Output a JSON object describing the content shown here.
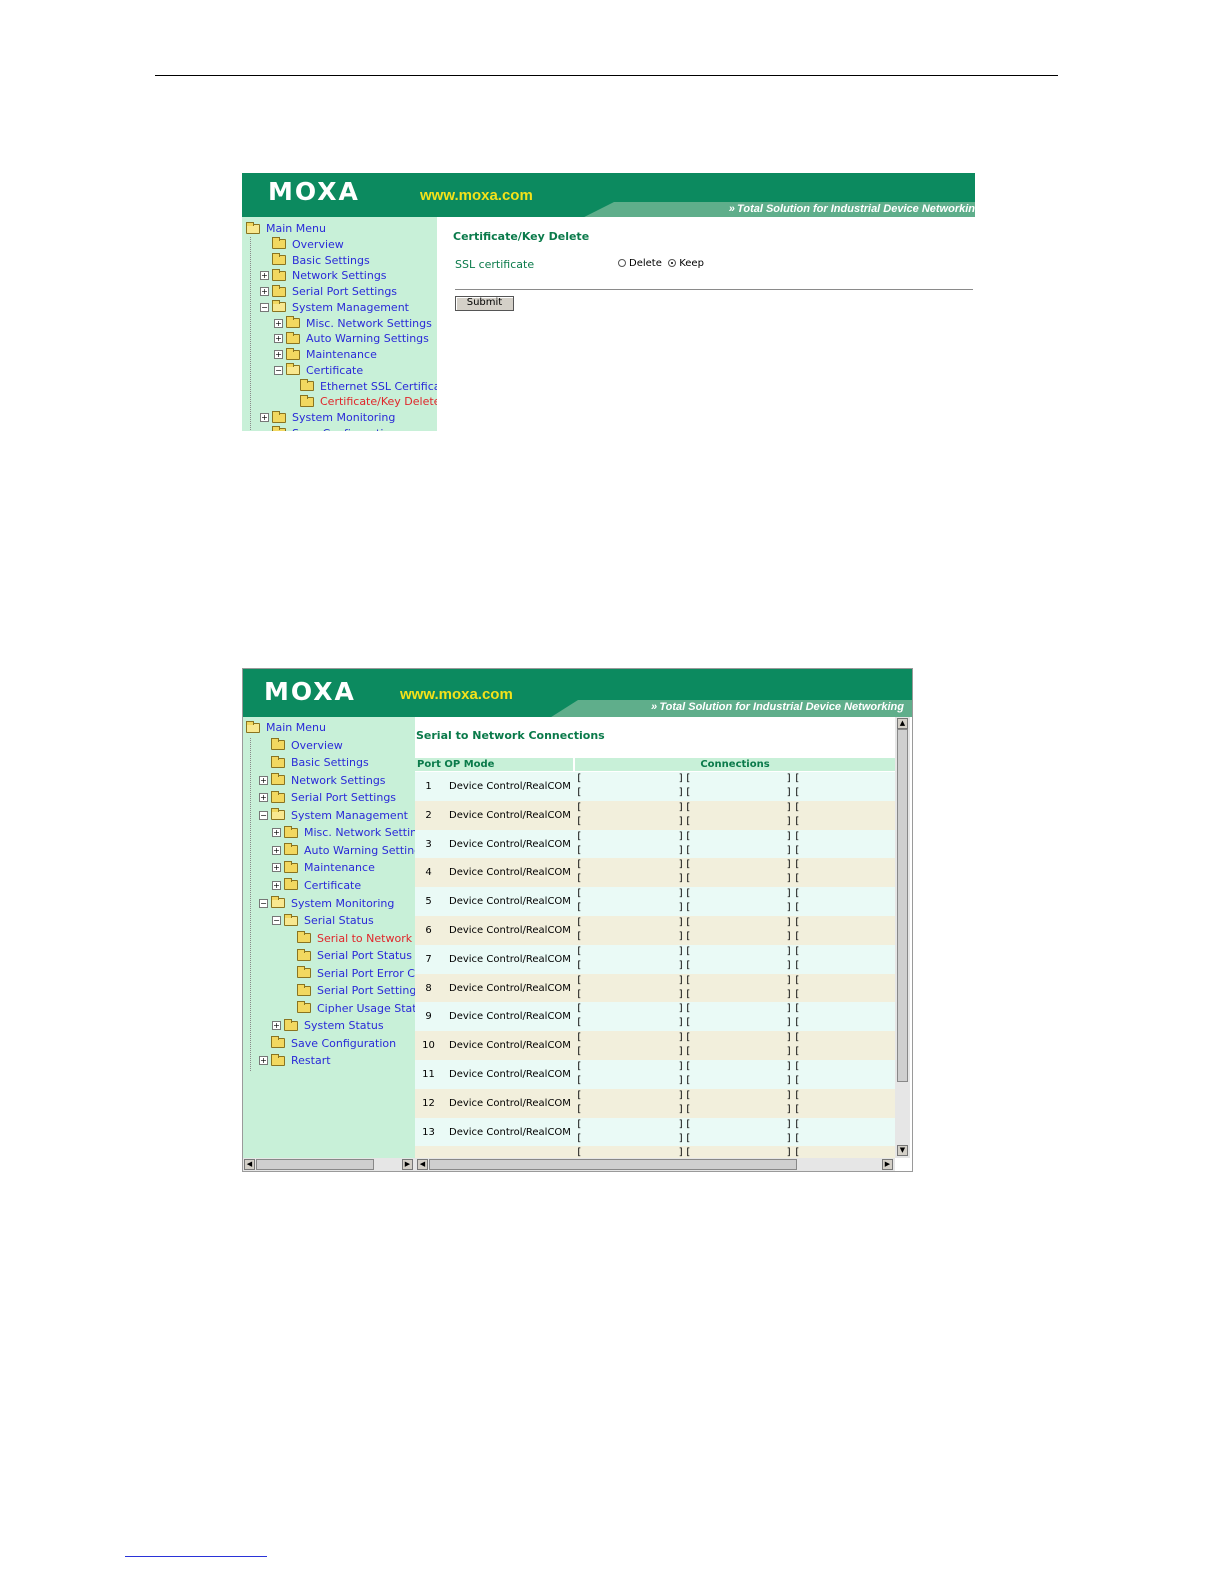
{
  "brand": {
    "logo": "MOXA",
    "url": "www.moxa.com",
    "tagline": "Total Solution for Industrial Device Networking"
  },
  "shot1": {
    "tagline": "Total Solution for Industrial Device Networkin",
    "menu": [
      {
        "label": "Main Menu",
        "level": 0,
        "expander": "",
        "open": true
      },
      {
        "label": "Overview",
        "level": 1,
        "expander": ""
      },
      {
        "label": "Basic Settings",
        "level": 1,
        "expander": ""
      },
      {
        "label": "Network Settings",
        "level": 1,
        "expander": "+"
      },
      {
        "label": "Serial Port Settings",
        "level": 1,
        "expander": "+"
      },
      {
        "label": "System Management",
        "level": 1,
        "expander": "-",
        "open": true
      },
      {
        "label": "Misc. Network Settings",
        "level": 2,
        "expander": "+"
      },
      {
        "label": "Auto Warning Settings",
        "level": 2,
        "expander": "+"
      },
      {
        "label": "Maintenance",
        "level": 2,
        "expander": "+"
      },
      {
        "label": "Certificate",
        "level": 2,
        "expander": "-",
        "open": true
      },
      {
        "label": "Ethernet SSL Certifica",
        "level": 3,
        "expander": ""
      },
      {
        "label": "Certificate/Key Delete",
        "level": 3,
        "expander": "",
        "active": true
      },
      {
        "label": "System Monitoring",
        "level": 1,
        "expander": "+"
      },
      {
        "label": "Save Configuration",
        "level": 1,
        "expander": ""
      }
    ],
    "title": "Certificate/Key Delete",
    "field_label": "SSL certificate",
    "options": [
      "Delete",
      "Keep"
    ],
    "selected": "Keep",
    "submit": "Submit"
  },
  "shot2": {
    "menu": [
      {
        "label": "Main Menu",
        "level": 0,
        "expander": "",
        "open": true
      },
      {
        "label": "Overview",
        "level": 1,
        "expander": ""
      },
      {
        "label": "Basic Settings",
        "level": 1,
        "expander": ""
      },
      {
        "label": "Network Settings",
        "level": 1,
        "expander": "+"
      },
      {
        "label": "Serial Port Settings",
        "level": 1,
        "expander": "+"
      },
      {
        "label": "System Management",
        "level": 1,
        "expander": "-",
        "open": true
      },
      {
        "label": "Misc. Network Settings",
        "level": 2,
        "expander": "+"
      },
      {
        "label": "Auto Warning Settings",
        "level": 2,
        "expander": "+"
      },
      {
        "label": "Maintenance",
        "level": 2,
        "expander": "+"
      },
      {
        "label": "Certificate",
        "level": 2,
        "expander": "+"
      },
      {
        "label": "System Monitoring",
        "level": 1,
        "expander": "-",
        "open": true
      },
      {
        "label": "Serial Status",
        "level": 2,
        "expander": "-",
        "open": true
      },
      {
        "label": "Serial to Network Con",
        "level": 3,
        "expander": "",
        "active": true
      },
      {
        "label": "Serial Port Status",
        "level": 3,
        "expander": ""
      },
      {
        "label": "Serial Port Error Coun",
        "level": 3,
        "expander": ""
      },
      {
        "label": "Serial Port Settings",
        "level": 3,
        "expander": ""
      },
      {
        "label": "Cipher Usage Status",
        "level": 3,
        "expander": ""
      },
      {
        "label": "System Status",
        "level": 2,
        "expander": "+"
      },
      {
        "label": "Save Configuration",
        "level": 1,
        "expander": ""
      },
      {
        "label": "Restart",
        "level": 1,
        "expander": "+"
      }
    ],
    "title": "Serial to Network Connections",
    "headers": {
      "port_mode": "Port OP Mode",
      "connections": "Connections"
    },
    "rows": [
      {
        "port": "1",
        "mode": "Device Control/RealCOM"
      },
      {
        "port": "2",
        "mode": "Device Control/RealCOM"
      },
      {
        "port": "3",
        "mode": "Device Control/RealCOM"
      },
      {
        "port": "4",
        "mode": "Device Control/RealCOM"
      },
      {
        "port": "5",
        "mode": "Device Control/RealCOM"
      },
      {
        "port": "6",
        "mode": "Device Control/RealCOM"
      },
      {
        "port": "7",
        "mode": "Device Control/RealCOM"
      },
      {
        "port": "8",
        "mode": "Device Control/RealCOM"
      },
      {
        "port": "9",
        "mode": "Device Control/RealCOM"
      },
      {
        "port": "10",
        "mode": "Device Control/RealCOM"
      },
      {
        "port": "11",
        "mode": "Device Control/RealCOM"
      },
      {
        "port": "12",
        "mode": "Device Control/RealCOM"
      },
      {
        "port": "13",
        "mode": "Device Control/RealCOM"
      }
    ],
    "colors": {
      "row_odd": "#eafaf6",
      "row_even": "#f2efdc",
      "sidebar": "#c8f0d8",
      "accent": "#0c8a5f"
    }
  }
}
